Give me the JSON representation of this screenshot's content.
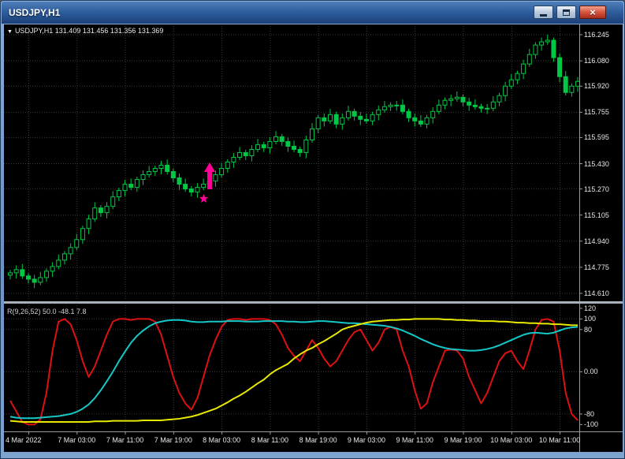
{
  "window": {
    "title": "USDJPY,H1",
    "close_glyph": "×"
  },
  "main_chart": {
    "dropdown_marker": "▼",
    "symbol_label": "USDJPY,H1 131.409 131.456 131.356 131.369"
  },
  "indicator": {
    "label": "R(9,26,52) 50.0 -48.1 7.8"
  },
  "annotations": [
    {
      "type": "buy-arrow",
      "candle_index": 33,
      "price": 115.31,
      "arrow_color": "#FF0096",
      "star_color": "#FF0096"
    }
  ],
  "chart_data": [
    {
      "type": "candlestick",
      "symbol": "USDJPY",
      "timeframe": "H1",
      "y_range": [
        114.565,
        116.3
      ],
      "y_ticks": [
        116.245,
        116.08,
        115.92,
        115.755,
        115.595,
        115.43,
        115.27,
        115.105,
        114.94,
        114.775,
        114.61
      ],
      "y_tick_labels": [
        "116.245",
        "116.080",
        "115.920",
        "115.755",
        "115.595",
        "115.430",
        "115.270",
        "115.105",
        "114.940",
        "114.775",
        "114.610"
      ],
      "x_tick_labels": [
        "4 Mar 2022",
        "7 Mar 03:00",
        "7 Mar 11:00",
        "7 Mar 19:00",
        "8 Mar 03:00",
        "8 Mar 11:00",
        "8 Mar 19:00",
        "9 Mar 03:00",
        "9 Mar 11:00",
        "9 Mar 19:00",
        "10 Mar 03:00",
        "10 Mar 11:00"
      ],
      "x_tick_indices": [
        3,
        11,
        19,
        27,
        35,
        43,
        51,
        59,
        67,
        75,
        83,
        91
      ],
      "bull_fill": "#000000",
      "bear_fill": "#00C846",
      "outline": "#00C846",
      "closes": [
        114.74,
        114.76,
        114.72,
        114.7,
        114.68,
        114.71,
        114.75,
        114.78,
        114.82,
        114.86,
        114.9,
        114.95,
        115.02,
        115.08,
        115.15,
        115.12,
        115.16,
        115.22,
        115.26,
        115.3,
        115.28,
        115.33,
        115.36,
        115.38,
        115.4,
        115.42,
        115.38,
        115.34,
        115.3,
        115.27,
        115.25,
        115.28,
        115.3,
        115.32,
        115.36,
        115.4,
        115.44,
        115.47,
        115.5,
        115.48,
        115.52,
        115.55,
        115.53,
        115.57,
        115.6,
        115.57,
        115.54,
        115.52,
        115.5,
        115.58,
        115.65,
        115.72,
        115.7,
        115.74,
        115.68,
        115.72,
        115.76,
        115.73,
        115.71,
        115.7,
        115.74,
        115.77,
        115.79,
        115.8,
        115.8,
        115.76,
        115.72,
        115.7,
        115.68,
        115.72,
        115.76,
        115.8,
        115.83,
        115.84,
        115.85,
        115.82,
        115.8,
        115.79,
        115.78,
        115.78,
        115.82,
        115.86,
        115.92,
        115.96,
        116.0,
        116.06,
        116.12,
        116.18,
        116.2,
        116.21,
        116.1,
        115.98,
        115.88,
        115.92,
        115.95
      ]
    },
    {
      "type": "line",
      "name": "R(9,26,52)",
      "y_range": [
        -110,
        123
      ],
      "y_ticks": [
        120,
        100,
        80,
        0,
        -80,
        -100
      ],
      "y_tick_labels": [
        "120",
        "100",
        "80",
        "0.00",
        "-80",
        "-100"
      ],
      "grid_levels": [
        100,
        80,
        0,
        -80
      ],
      "series": [
        {
          "name": "fast-9",
          "color": "#DD1111",
          "values": [
            -55,
            -75,
            -95,
            -100,
            -100,
            -90,
            -40,
            40,
            95,
            100,
            90,
            60,
            20,
            -10,
            10,
            40,
            70,
            95,
            100,
            100,
            98,
            100,
            100,
            100,
            95,
            70,
            30,
            -10,
            -40,
            -60,
            -72,
            -50,
            -10,
            30,
            60,
            85,
            98,
            100,
            100,
            98,
            100,
            100,
            100,
            98,
            90,
            70,
            45,
            30,
            20,
            40,
            60,
            45,
            25,
            10,
            20,
            40,
            60,
            75,
            80,
            60,
            40,
            55,
            80,
            85,
            80,
            40,
            10,
            -35,
            -70,
            -60,
            -20,
            10,
            40,
            42,
            40,
            25,
            -10,
            -35,
            -60,
            -40,
            -10,
            20,
            35,
            40,
            20,
            5,
            40,
            80,
            98,
            100,
            95,
            40,
            -40,
            -80,
            -92
          ]
        },
        {
          "name": "mid-26",
          "color": "#14C8C8",
          "values": [
            -85,
            -87,
            -88,
            -88,
            -88,
            -87,
            -86,
            -85,
            -84,
            -82,
            -80,
            -76,
            -70,
            -62,
            -50,
            -35,
            -18,
            0,
            20,
            38,
            55,
            68,
            78,
            86,
            92,
            95,
            97,
            98,
            98,
            97,
            95,
            94,
            94,
            95,
            95,
            95,
            96,
            96,
            96,
            95,
            95,
            95,
            96,
            96,
            96,
            96,
            95,
            95,
            94,
            94,
            95,
            96,
            96,
            95,
            94,
            93,
            92,
            92,
            91,
            90,
            89,
            88,
            87,
            85,
            82,
            78,
            73,
            68,
            62,
            57,
            52,
            48,
            45,
            43,
            42,
            41,
            40,
            40,
            41,
            43,
            46,
            50,
            55,
            60,
            65,
            70,
            73,
            74,
            73,
            72,
            74,
            78,
            82,
            84,
            85
          ]
        },
        {
          "name": "slow-52",
          "color": "#E8E800",
          "values": [
            -93,
            -94,
            -95,
            -95,
            -95,
            -95,
            -95,
            -95,
            -95,
            -95,
            -95,
            -95,
            -95,
            -95,
            -94,
            -94,
            -94,
            -93,
            -93,
            -93,
            -93,
            -93,
            -92,
            -92,
            -92,
            -92,
            -91,
            -90,
            -89,
            -87,
            -85,
            -82,
            -78,
            -74,
            -70,
            -64,
            -58,
            -51,
            -45,
            -38,
            -30,
            -22,
            -15,
            -5,
            3,
            9,
            15,
            25,
            33,
            40,
            45,
            52,
            58,
            65,
            72,
            80,
            84,
            87,
            90,
            93,
            95,
            96,
            97,
            98,
            98,
            99,
            99,
            100,
            100,
            100,
            100,
            100,
            99,
            99,
            98,
            98,
            97,
            97,
            96,
            96,
            96,
            95,
            95,
            94,
            93,
            93,
            92,
            92,
            91,
            91,
            90,
            90,
            89,
            88,
            88
          ]
        }
      ]
    }
  ]
}
